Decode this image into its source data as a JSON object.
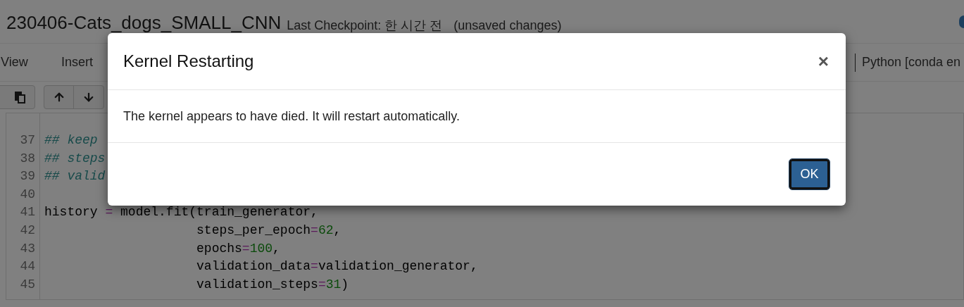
{
  "notebook": {
    "name": "230406-Cats_dogs_SMALL_CNN",
    "checkpoint": "Last Checkpoint: 한 시간 전",
    "unsaved": "(unsaved changes)"
  },
  "menu": [
    {
      "label": "View"
    },
    {
      "label": "Insert"
    }
  ],
  "kernel": {
    "label": "Python [conda en"
  },
  "code": [
    {
      "number": "37",
      "tokens": [
        {
          "kind": "comment",
          "text": "## keep"
        }
      ]
    },
    {
      "number": "38",
      "tokens": [
        {
          "kind": "comment",
          "text": "## steps"
        }
      ]
    },
    {
      "number": "39",
      "tokens": [
        {
          "kind": "comment",
          "text": "## valid"
        }
      ]
    },
    {
      "number": "40"
    },
    {
      "number": "41",
      "tokens": [
        {
          "kind": "plain",
          "text": "history "
        },
        {
          "kind": "operator",
          "text": "="
        },
        {
          "kind": "plain",
          "text": " model.fit(train_generator,"
        }
      ]
    },
    {
      "number": "42",
      "tokens": [
        {
          "kind": "plain",
          "text": "                    steps_per_epoch"
        },
        {
          "kind": "operator",
          "text": "="
        },
        {
          "kind": "number",
          "text": "62"
        },
        {
          "kind": "plain",
          "text": ","
        }
      ]
    },
    {
      "number": "43",
      "tokens": [
        {
          "kind": "plain",
          "text": "                    epochs"
        },
        {
          "kind": "operator",
          "text": "="
        },
        {
          "kind": "number",
          "text": "100"
        },
        {
          "kind": "plain",
          "text": ","
        }
      ]
    },
    {
      "number": "44",
      "tokens": [
        {
          "kind": "plain",
          "text": "                    validation_data"
        },
        {
          "kind": "operator",
          "text": "="
        },
        {
          "kind": "plain",
          "text": "validation_generator,"
        }
      ]
    },
    {
      "number": "45",
      "tokens": [
        {
          "kind": "plain",
          "text": "                    validation_steps"
        },
        {
          "kind": "operator",
          "text": "="
        },
        {
          "kind": "number",
          "text": "31"
        },
        {
          "kind": "plain",
          "text": ")"
        }
      ]
    }
  ],
  "dialog": {
    "title": "Kernel Restarting",
    "close": "×",
    "message": "The kernel appears to have died. It will restart automatically.",
    "button": "OK"
  }
}
